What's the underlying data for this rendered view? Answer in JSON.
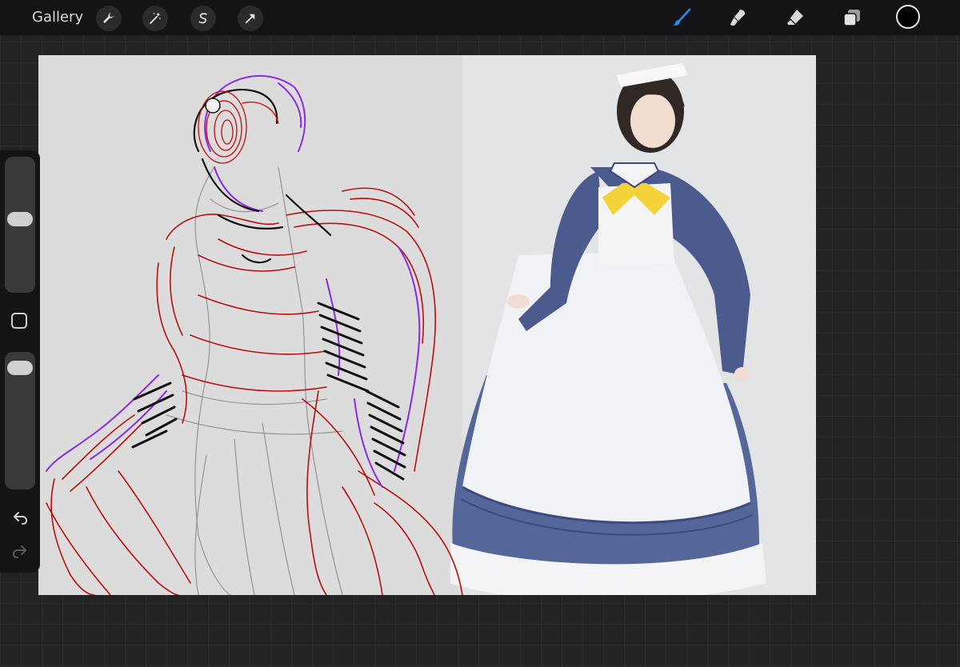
{
  "app": {
    "gallery_label": "Gallery"
  },
  "toolbar_left": [
    {
      "name": "actions-wrench-icon"
    },
    {
      "name": "adjustments-magic-wand-icon"
    },
    {
      "name": "selection-s-icon"
    },
    {
      "name": "transform-arrow-icon"
    }
  ],
  "toolbar_right": [
    {
      "name": "brush-icon",
      "active": true,
      "color": "#1f8ef5"
    },
    {
      "name": "smudge-icon",
      "active": false
    },
    {
      "name": "eraser-icon",
      "active": false
    },
    {
      "name": "layers-icon",
      "active": false
    }
  ],
  "current_color": "#000000",
  "sidebar": {
    "brush_size_level": 0.55,
    "opacity_level": 0.95,
    "undo": "undo-icon",
    "redo": "redo-icon"
  },
  "colors": {
    "toolbar_bg": "#141416",
    "workspace_bg": "#232325",
    "canvas_bg": "#dcdcdc",
    "sketch_red": "#b80f0f",
    "sketch_purple": "#8a2be2",
    "sketch_black": "#111111",
    "sketch_gray": "#8c8c8c",
    "dress_navy": "#4a5a8c",
    "apron_white": "#f2f3f6",
    "bow_yellow": "#f3d23a"
  }
}
